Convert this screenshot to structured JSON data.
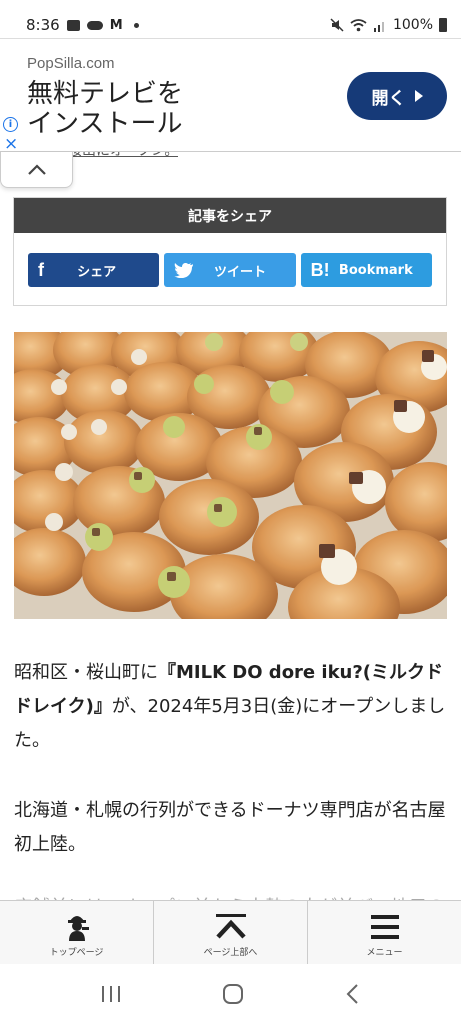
{
  "status_bar": {
    "time": "8:36",
    "mail_icon": "M",
    "battery": "100%"
  },
  "ad": {
    "domain": "PopSilla.com",
    "headline_line1": "無料テレビを",
    "headline_line2": "インストール",
    "open_button": "開く",
    "info_icon": "i",
    "close_icon": "×",
    "accent_color": "#163a78"
  },
  "partial_link_text": "舗が桜山にオープン。",
  "share": {
    "title": "記事をシェア",
    "facebook_label": "シェア",
    "facebook_glyph": "f",
    "twitter_label": "ツイート",
    "hatena_label": "Bookmark",
    "hatena_glyph": "B!"
  },
  "article": {
    "p1_a": "昭和区・桜山町に",
    "p1_b": "『MILK DO dore iku?(ミルクドドレイク)』",
    "p1_c": "が、2024年5月3日(金)にオープンしました。",
    "p2": "北海道・札幌の行列ができるドーナツ専門店が名古屋初上陸。",
    "p3_partial": "店舗前には、オープン前から大勢の人が並び、地元の人気"
  },
  "bottom_nav": {
    "top_page": "トップページ",
    "page_top": "ページ上部へ",
    "menu": "メニュー"
  }
}
